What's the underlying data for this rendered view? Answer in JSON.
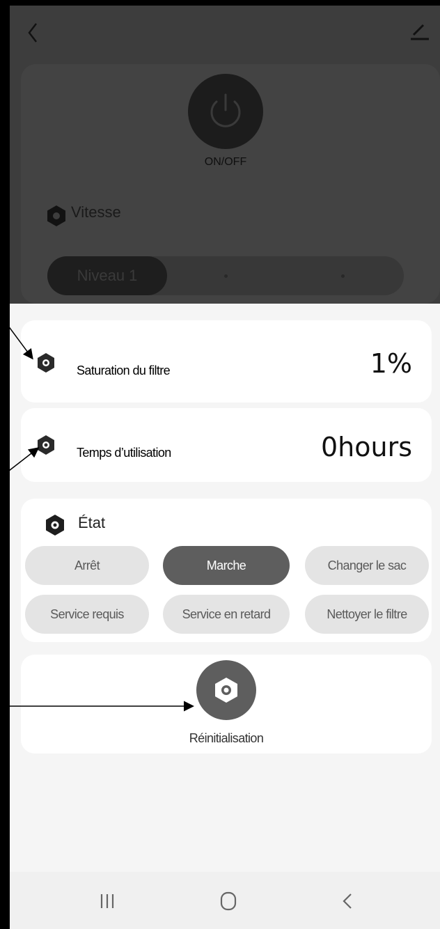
{
  "header": {
    "back_icon": "chevron-left-icon",
    "edit_icon": "pencil-icon"
  },
  "power": {
    "label": "ON/OFF",
    "icon": "power-icon"
  },
  "vitesse": {
    "label": "Vitesse",
    "selected": "Niveau 1"
  },
  "filter_saturation": {
    "label": "Saturation du filtre",
    "value": "1%"
  },
  "usage_time": {
    "label": "Temps d’utilisation",
    "value": "0hours"
  },
  "state": {
    "label": "État",
    "options": [
      "Arrêt",
      "Marche",
      "Changer le sac",
      "Service requis",
      "Service en retard",
      "Nettoyer le filtre"
    ],
    "selected": "Marche"
  },
  "reset": {
    "label": "Réinitialisation",
    "icon": "hexagon-nut-icon"
  },
  "navbar": {
    "recent_icon": "recent-apps-icon",
    "home_icon": "home-icon",
    "back_icon": "back-icon"
  },
  "colors": {
    "active_chip": "#5e5e5e",
    "chip": "#e4e4e4",
    "overlay": "#3d3d3d"
  }
}
